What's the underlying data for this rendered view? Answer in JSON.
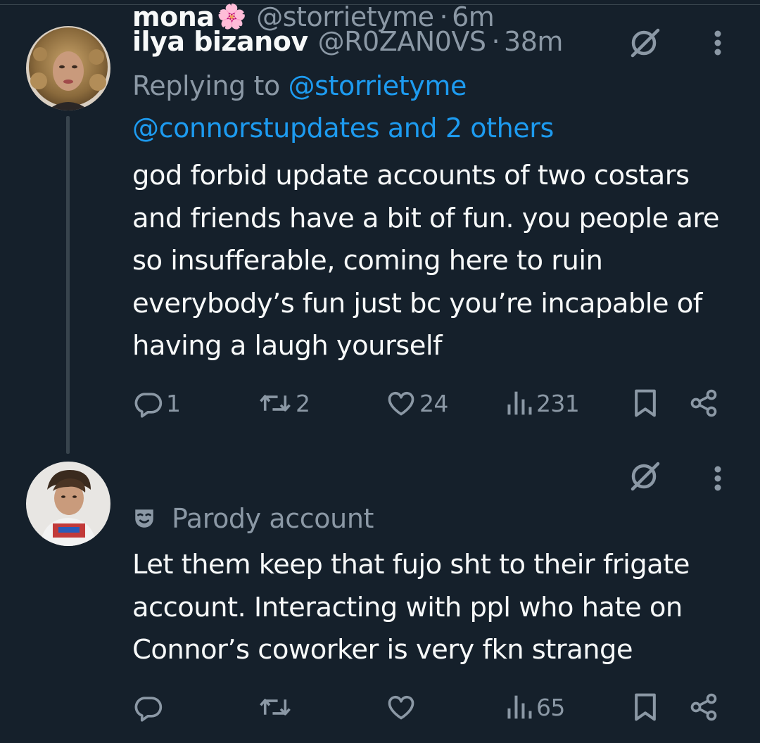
{
  "colors": {
    "background": "#15202b",
    "text_primary": "#f7f9f9",
    "text_secondary": "#8b98a5",
    "link": "#1d9bf0",
    "divider": "#38444d"
  },
  "tweets": [
    {
      "display_name": "ilya bizanov",
      "handle": "@R0ZAN0VS",
      "separator": "·",
      "time": "38m",
      "replying_prefix": "Replying to ",
      "replying_mention_1": "@storrietyme",
      "replying_mention_2": "@connorstupdates and 2 others",
      "body": "god forbid update accounts of two costars and friends have a bit of fun. you people are so insufferable, coming here to ruin everybody’s fun just bc you’re incapable of having a laugh yourself",
      "replies": "1",
      "reposts": "2",
      "likes": "24",
      "views": "231",
      "icons": [
        "grok-icon",
        "more-icon",
        "reply-icon",
        "repost-icon",
        "like-icon",
        "views-icon",
        "bookmark-icon",
        "share-icon"
      ]
    },
    {
      "display_name": "mona",
      "emoji": "🌸",
      "handle": "@storrietyme",
      "separator": "·",
      "time": "6m",
      "parody_label": "Parody account",
      "body": "Let them keep that fujo sht to their frigate account. Interacting with ppl who hate on Connor’s coworker is very fkn strange",
      "replies": "",
      "reposts": "",
      "likes": "",
      "views": "65",
      "icons": [
        "grok-icon",
        "more-icon",
        "mask-icon",
        "reply-icon",
        "repost-icon",
        "like-icon",
        "views-icon",
        "bookmark-icon",
        "share-icon"
      ]
    }
  ]
}
